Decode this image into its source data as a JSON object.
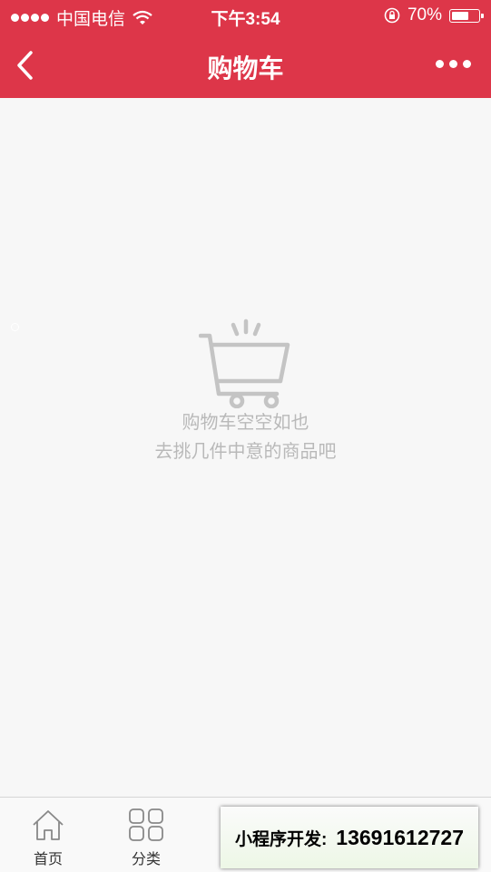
{
  "status_bar": {
    "carrier": "中国电信",
    "time": "下午3:54",
    "battery": "70%",
    "battery_level": 0.7
  },
  "nav": {
    "title": "购物车",
    "back_icon": "chevron-left-icon",
    "more_icon": "more-dots-icon"
  },
  "empty_state": {
    "icon": "shopping-cart-icon",
    "line1": "购物车空空如也",
    "line2": "去挑几件中意的商品吧"
  },
  "tabbar": {
    "items": [
      {
        "label": "首页",
        "icon": "home-icon"
      },
      {
        "label": "分类",
        "icon": "grid-icon"
      }
    ]
  },
  "promo": {
    "label": "小程序开发:",
    "phone": "13691612727"
  },
  "colors": {
    "brand": "#dd3649",
    "muted_text": "#b9b9b9"
  }
}
